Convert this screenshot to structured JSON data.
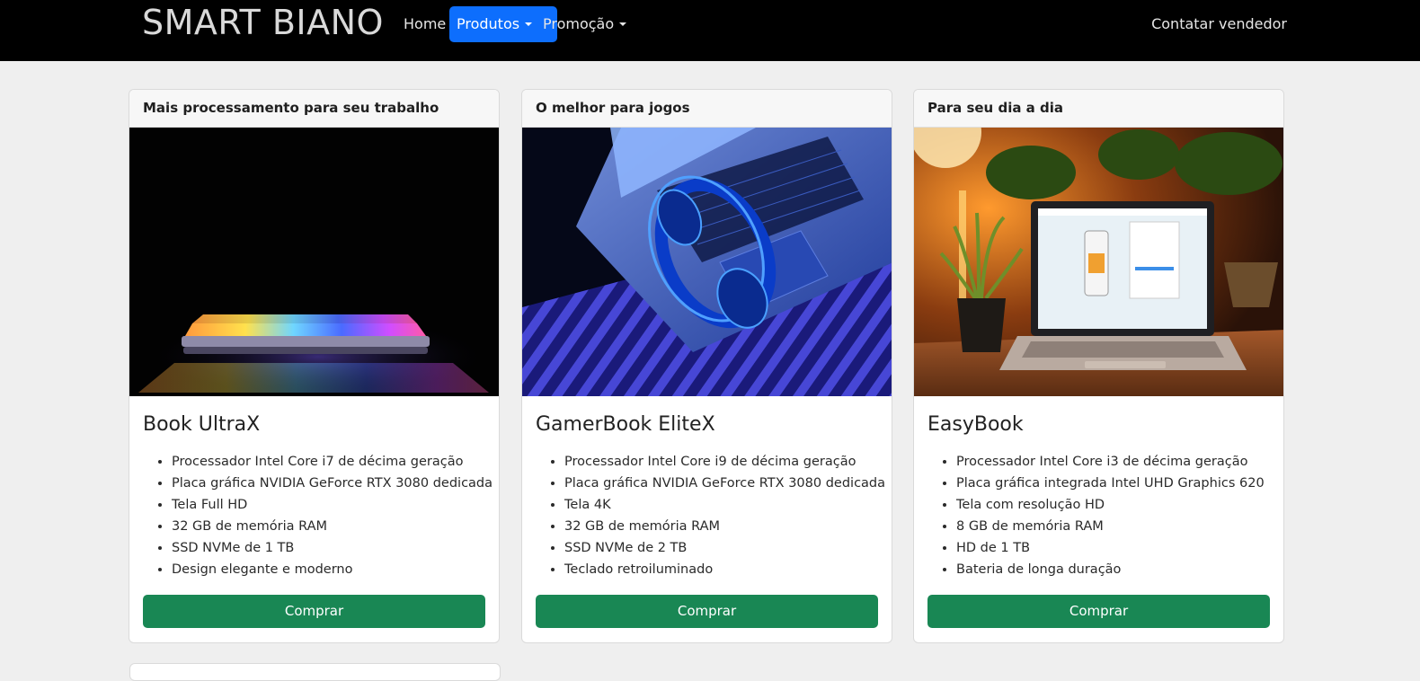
{
  "navbar": {
    "brand": "SMART BIANO",
    "home": "Home",
    "produtos": "Produtos",
    "promocao": "Promoção",
    "contact": "Contatar vendedor",
    "active_color": "#0d6efd"
  },
  "cards": [
    {
      "header": "Mais processamento para seu trabalho",
      "title": "Book UltraX",
      "specs": [
        "Processador Intel Core i7 de décima geração",
        "Placa gráfica NVIDIA GeForce RTX 3080 dedicada",
        "Tela Full HD",
        "32 GB de memória RAM",
        "SSD NVMe de 1 TB",
        "Design elegante e moderno"
      ],
      "button": "Comprar"
    },
    {
      "header": "O melhor para jogos",
      "title": "GamerBook EliteX",
      "specs": [
        "Processador Intel Core i9 de décima geração",
        "Placa gráfica NVIDIA GeForce RTX 3080 dedicada",
        "Tela 4K",
        "32 GB de memória RAM",
        "SSD NVMe de 2 TB",
        "Teclado retroiluminado"
      ],
      "button": "Comprar"
    },
    {
      "header": "Para seu dia a dia",
      "title": "EasyBook",
      "specs": [
        "Processador Intel Core i3 de décima geração",
        "Placa gráfica integrada Intel UHD Graphics 620",
        "Tela com resolução HD",
        "8 GB de memória RAM",
        "HD de 1 TB",
        "Bateria de longa duração"
      ],
      "button": "Comprar"
    }
  ],
  "colors": {
    "button": "#198754",
    "navbar": "#000000",
    "page": "#efefef"
  }
}
